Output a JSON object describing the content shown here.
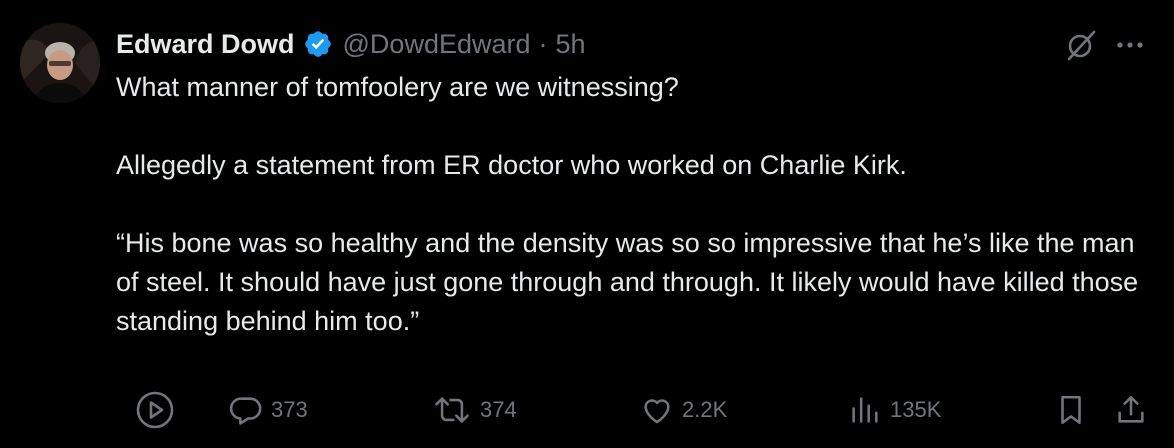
{
  "author": {
    "name": "Edward Dowd",
    "handle": "@DowdEdward",
    "separator": "·",
    "time": "5h"
  },
  "body": {
    "line1": "What manner of tomfoolery are we witnessing?",
    "line2": "Allegedly a statement from ER doctor who worked on Charlie Kirk.",
    "line3": "“His bone was so healthy and the density was so so impressive that he’s like the man of steel. It should have just gone through and through. It likely would have killed those standing behind him too.”"
  },
  "actions": {
    "replies": "373",
    "reposts": "374",
    "likes": "2.2K",
    "views": "135K"
  },
  "colors": {
    "background": "#000000",
    "text": "#e7e9ea",
    "muted": "#71767b",
    "verified": "#1d9bf0"
  },
  "icons": {
    "verified": "verified-badge-icon",
    "grok": "grok-icon",
    "more": "more-icon",
    "video": "play-circle-icon",
    "reply": "reply-icon",
    "repost": "repost-icon",
    "like": "heart-icon",
    "views": "views-icon",
    "bookmark": "bookmark-icon",
    "share": "share-icon"
  }
}
